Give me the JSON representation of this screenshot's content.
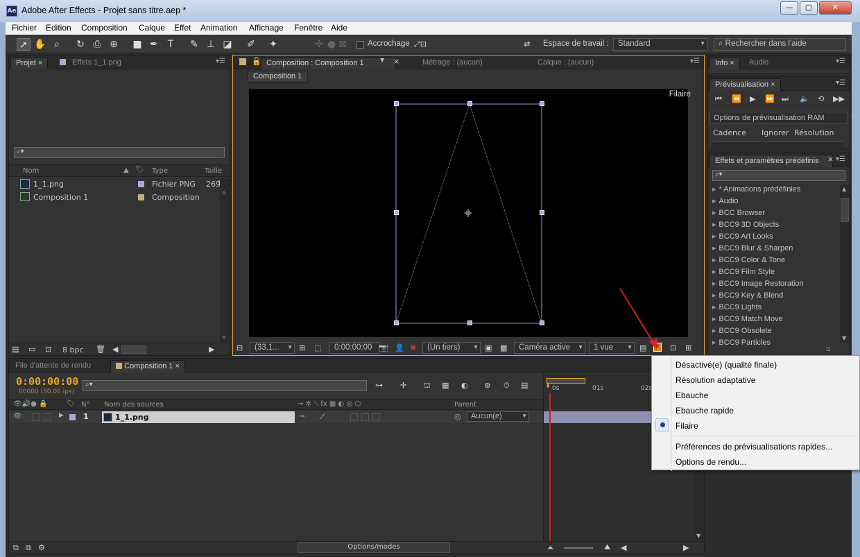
{
  "window": {
    "title": "Adobe After Effects - Projet sans titre.aep *",
    "logo": "Ae"
  },
  "menubar": [
    "Fichier",
    "Edition",
    "Composition",
    "Calque",
    "Effet",
    "Animation",
    "Affichage",
    "Fenêtre",
    "Aide"
  ],
  "toolbar": {
    "snapping_label": "Accrochage",
    "workspace_label": "Espace de travail :",
    "workspace_value": "Standard",
    "help_search_placeholder": "Rechercher dans l'aide"
  },
  "project_panel": {
    "tabs": [
      "Projet",
      "Effets 1_1.png"
    ],
    "columns": {
      "name": "Nom",
      "type": "Type",
      "size": "Taille"
    },
    "items": [
      {
        "name": "1_1.png",
        "type": "Fichier PNG",
        "size": "269",
        "label_color": "#a9a9d9"
      },
      {
        "name": "Composition 1",
        "type": "Composition",
        "size": "",
        "label_color": "#c9ae7d"
      }
    ],
    "bpc": "8 bpc"
  },
  "comp_panel": {
    "tabs": [
      "Composition : Composition 1",
      "Métrage : (aucun)",
      "Calque : (aucun)"
    ],
    "breadcrumb": "Composition 1",
    "render_mode_label": "Filaire",
    "footer": {
      "zoom": "(33,1...",
      "timecode": "0:00:00:00",
      "resolution": "(Un tiers)",
      "camera": "Caméra active",
      "views": "1 vue"
    }
  },
  "info_panel": {
    "tabs": [
      "Info",
      "Audio"
    ]
  },
  "preview_panel": {
    "title": "Prévisualisation",
    "ram_options": "Options de prévisualisation RAM",
    "labels": [
      "Cadence",
      "Ignorer",
      "Résolution"
    ]
  },
  "effects_panel": {
    "title": "Effets et paramètres prédéfinis",
    "items": [
      "* Animations prédéfinies",
      "Audio",
      "BCC Browser",
      "BCC9 3D Objects",
      "BCC9 Art Looks",
      "BCC9 Blur & Sharpen",
      "BCC9 Color & Tone",
      "BCC9 Film Style",
      "BCC9 Image Restoration",
      "BCC9 Key & Blend",
      "BCC9 Lights",
      "BCC9 Match Move",
      "BCC9 Obsolete",
      "BCC9 Particles"
    ]
  },
  "timeline": {
    "tabs": [
      "File d'attente de rendu",
      "Composition 1"
    ],
    "timecode": "0:00:00:00",
    "fps": "00000 (50.00 ips)",
    "columns": {
      "num": "N°",
      "source": "Nom des sources",
      "parent": "Parent"
    },
    "layers": [
      {
        "num": "1",
        "name": "1_1.png",
        "parent": "Aucun(e)"
      }
    ],
    "ruler": [
      "0s",
      "01s",
      "02s"
    ],
    "footer_mode": "Options/modes"
  },
  "context_menu": {
    "items": [
      {
        "label": "Désactivé(e) (qualité finale)",
        "checked": false
      },
      {
        "label": "Résolution adaptative",
        "checked": false
      },
      {
        "label": "Ebauche",
        "checked": false
      },
      {
        "label": "Ebauche rapide",
        "checked": false
      },
      {
        "label": "Filaire",
        "checked": true
      }
    ],
    "extra": [
      "Préférences de prévisualisations rapides...",
      "Options de rendu..."
    ]
  },
  "colors": {
    "accent_orange": "#e5a52a",
    "annotation_arrow": "#e02020",
    "playhead": "#d02020"
  }
}
